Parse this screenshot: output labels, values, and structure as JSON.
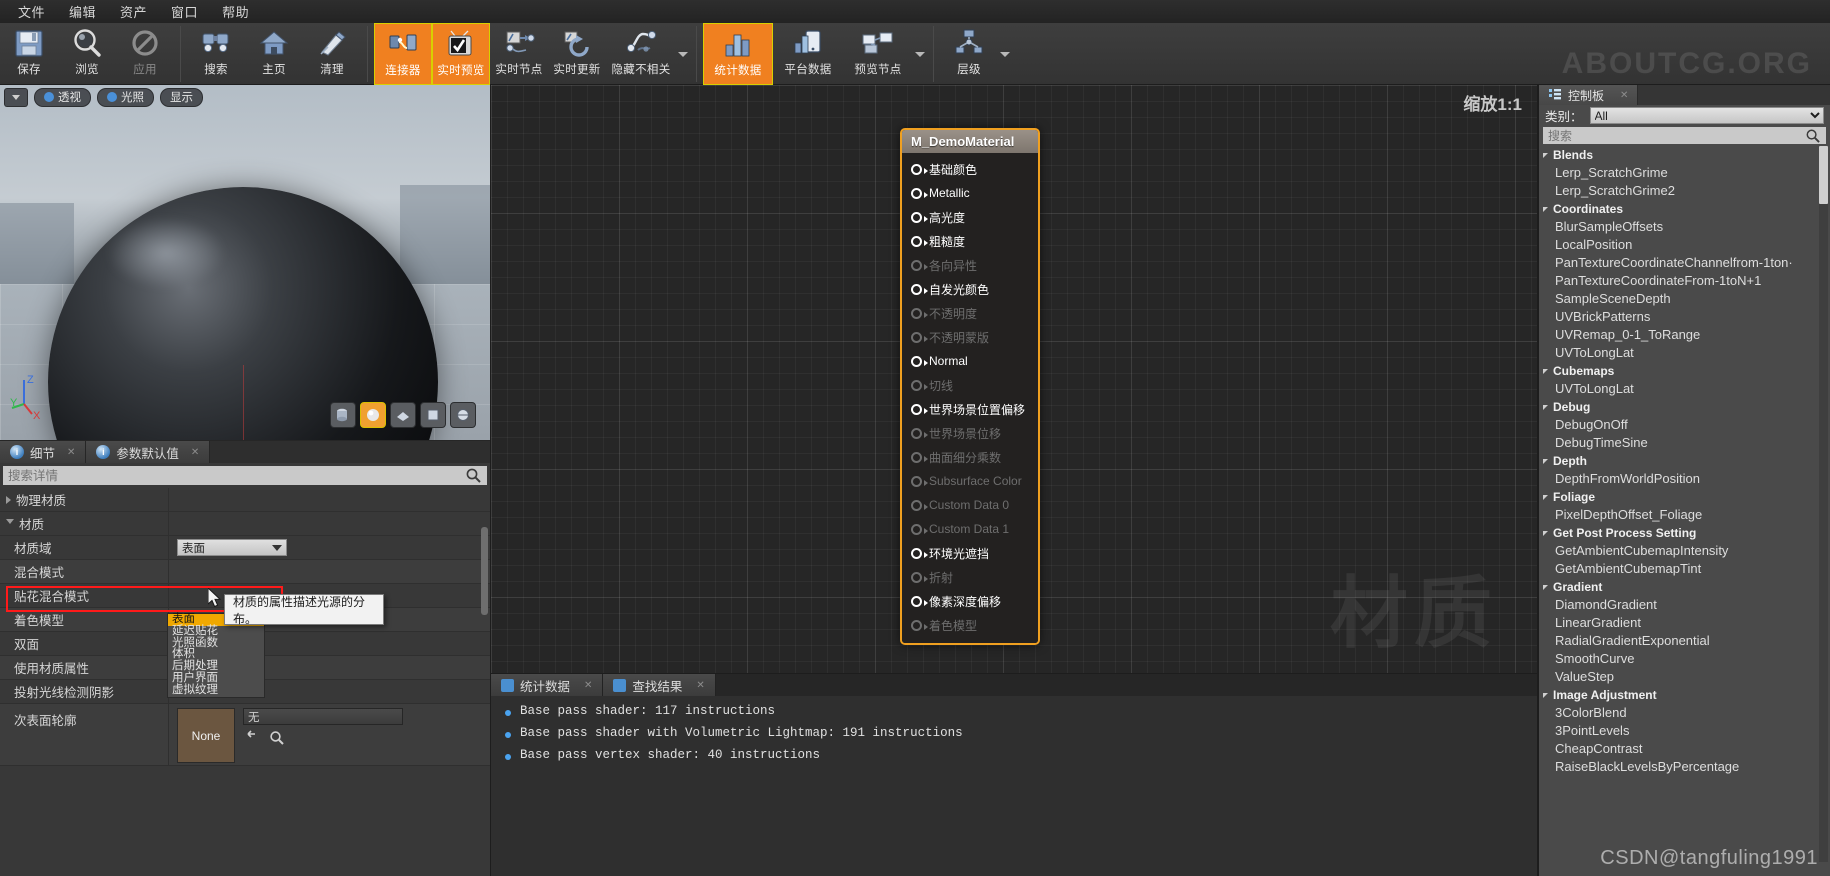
{
  "menubar": {
    "items": [
      "文件",
      "编辑",
      "资产",
      "窗口",
      "帮助"
    ]
  },
  "toolbar": {
    "watermark": "ABOUTCG.ORG",
    "items": [
      {
        "label": "保存",
        "icon": "save-icon",
        "state": "normal"
      },
      {
        "label": "浏览",
        "icon": "browse-icon",
        "state": "normal"
      },
      {
        "label": "应用",
        "icon": "apply-icon",
        "state": "disabled"
      },
      {
        "label": "搜索",
        "icon": "search-icon",
        "state": "normal"
      },
      {
        "label": "主页",
        "icon": "home-icon",
        "state": "normal"
      },
      {
        "label": "清理",
        "icon": "clean-icon",
        "state": "normal"
      },
      {
        "label": "连接器",
        "icon": "connector-icon",
        "state": "active"
      },
      {
        "label": "实时预览",
        "icon": "live-preview-icon",
        "state": "active"
      },
      {
        "label": "实时节点",
        "icon": "live-nodes-icon",
        "state": "normal"
      },
      {
        "label": "实时更新",
        "icon": "live-update-icon",
        "state": "normal"
      },
      {
        "label": "隐藏不相关",
        "icon": "hide-unrelated-icon",
        "state": "normal"
      },
      {
        "label": "统计数据",
        "icon": "stats-icon",
        "state": "active"
      },
      {
        "label": "平台数据",
        "icon": "platform-stats-icon",
        "state": "normal"
      },
      {
        "label": "预览节点",
        "icon": "preview-node-icon",
        "state": "normal"
      },
      {
        "label": "层级",
        "icon": "hierarchy-icon",
        "state": "normal"
      }
    ]
  },
  "viewport": {
    "buttons": [
      "透视",
      "光照",
      "显示"
    ],
    "axes": {
      "x": "X",
      "y": "Y",
      "z": "Z"
    }
  },
  "details": {
    "tabs": [
      {
        "label": "细节",
        "active": true
      },
      {
        "label": "参数默认值",
        "active": false
      }
    ],
    "search_placeholder": "搜索详情",
    "search_value": "",
    "rows": [
      {
        "label": "物理材质",
        "type": "category",
        "expanded": false
      },
      {
        "label": "材质",
        "type": "category",
        "expanded": true
      },
      {
        "label": "材质域",
        "type": "combo",
        "value": "表面",
        "highlighted": true
      },
      {
        "label": "混合模式",
        "type": "combo",
        "value": ""
      },
      {
        "label": "贴花混合模式",
        "type": "combo",
        "value": ""
      },
      {
        "label": "着色模型",
        "type": "combo",
        "value": ""
      },
      {
        "label": "双面",
        "type": "checkbox",
        "checked": false
      },
      {
        "label": "使用材质属性",
        "type": "checkbox",
        "checked": false
      },
      {
        "label": "投射光线检测阴影",
        "type": "checkbox",
        "checked": true
      },
      {
        "label": "次表面轮廓",
        "type": "asset",
        "value": "无",
        "thumb": "None"
      }
    ],
    "dropdown": {
      "options": [
        "表面",
        "延迟贴花",
        "光照函数",
        "体积",
        "后期处理",
        "用户界面",
        "虚拟纹理"
      ],
      "selected": "表面"
    },
    "tooltip": "材质的属性描述光源的分布。"
  },
  "graph": {
    "zoom_label": "缩放1:1",
    "watermark": "材质",
    "node": {
      "title": "M_DemoMaterial",
      "pins": [
        {
          "label": "基础颜色",
          "enabled": true
        },
        {
          "label": "Metallic",
          "enabled": true
        },
        {
          "label": "高光度",
          "enabled": true
        },
        {
          "label": "粗糙度",
          "enabled": true
        },
        {
          "label": "各向异性",
          "enabled": false
        },
        {
          "label": "自发光颜色",
          "enabled": true
        },
        {
          "label": "不透明度",
          "enabled": false
        },
        {
          "label": "不透明蒙版",
          "enabled": false
        },
        {
          "label": "Normal",
          "enabled": true
        },
        {
          "label": "切线",
          "enabled": false
        },
        {
          "label": "世界场景位置偏移",
          "enabled": true
        },
        {
          "label": "世界场景位移",
          "enabled": false
        },
        {
          "label": "曲面细分乘数",
          "enabled": false
        },
        {
          "label": "Subsurface Color",
          "enabled": false
        },
        {
          "label": "Custom Data 0",
          "enabled": false
        },
        {
          "label": "Custom Data 1",
          "enabled": false
        },
        {
          "label": "环境光遮挡",
          "enabled": true
        },
        {
          "label": "折射",
          "enabled": false
        },
        {
          "label": "像素深度偏移",
          "enabled": true
        },
        {
          "label": "着色模型",
          "enabled": false
        }
      ]
    }
  },
  "stats": {
    "tabs": [
      {
        "label": "统计数据",
        "active": true
      },
      {
        "label": "查找结果",
        "active": false
      }
    ],
    "lines": [
      "Base pass shader: 117 instructions",
      "Base pass shader with Volumetric Lightmap: 191 instructions",
      "Base pass vertex shader: 40 instructions"
    ]
  },
  "palette": {
    "tab_label": "控制板",
    "category_label": "类别：",
    "category_value": "All",
    "search_placeholder": "搜索",
    "search_value": "",
    "groups": [
      {
        "name": "Blends",
        "items": [
          "Lerp_ScratchGrime",
          "Lerp_ScratchGrime2"
        ]
      },
      {
        "name": "Coordinates",
        "items": [
          "BlurSampleOffsets",
          "LocalPosition",
          "PanTextureCoordinateChannelfrom-1ton·",
          "PanTextureCoordinateFrom-1toN+1",
          "SampleSceneDepth",
          "UVBrickPatterns",
          "UVRemap_0-1_ToRange",
          "UVToLongLat"
        ]
      },
      {
        "name": "Cubemaps",
        "items": [
          "UVToLongLat"
        ]
      },
      {
        "name": "Debug",
        "items": [
          "DebugOnOff",
          "DebugTimeSine"
        ]
      },
      {
        "name": "Depth",
        "items": [
          "DepthFromWorldPosition"
        ]
      },
      {
        "name": "Foliage",
        "items": [
          "PixelDepthOffset_Foliage"
        ]
      },
      {
        "name": "Get Post Process Setting",
        "items": [
          "GetAmbientCubemapIntensity",
          "GetAmbientCubemapTint"
        ]
      },
      {
        "name": "Gradient",
        "items": [
          "DiamondGradient",
          "LinearGradient",
          "RadialGradientExponential",
          "SmoothCurve",
          "ValueStep"
        ]
      },
      {
        "name": "Image Adjustment",
        "items": [
          "3ColorBlend",
          "3PointLevels",
          "CheapContrast",
          "RaiseBlackLevelsByPercentage"
        ]
      }
    ],
    "watermark": "CSDN@tangfuling1991"
  }
}
